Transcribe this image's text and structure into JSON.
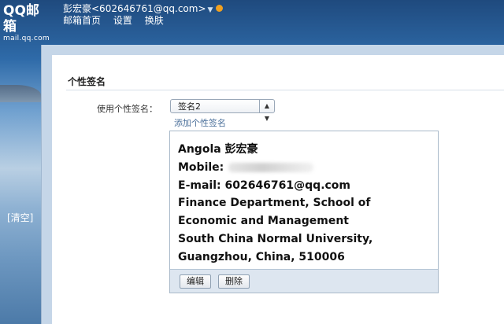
{
  "brand": {
    "logo_main": "QQ邮箱",
    "logo_sub": "mail.qq.com"
  },
  "user": {
    "display": "彭宏豪<602646761@qq.com>",
    "dropdown_icon": "chevron-down-icon",
    "status_icon": "notification-dot-icon"
  },
  "nav": {
    "home": "邮箱首页",
    "settings": "设置",
    "skin": "换肤"
  },
  "sidebar": {
    "clear": "[清空]"
  },
  "settings": {
    "section_title": "个性签名",
    "use_label": "使用个性签名：",
    "select_value": "签名2",
    "add_link": "添加个性签名"
  },
  "signature": {
    "line1": "Angola 彭宏豪",
    "mobile_label": "Mobile:",
    "email": "E-mail: 602646761@qq.com",
    "line4": "Finance Department, School of",
    "line5": "Economic and Management",
    "line6": "South China Normal University,",
    "line7": "Guangzhou, China, 510006"
  },
  "actions": {
    "edit": "编辑",
    "delete": "删除"
  }
}
